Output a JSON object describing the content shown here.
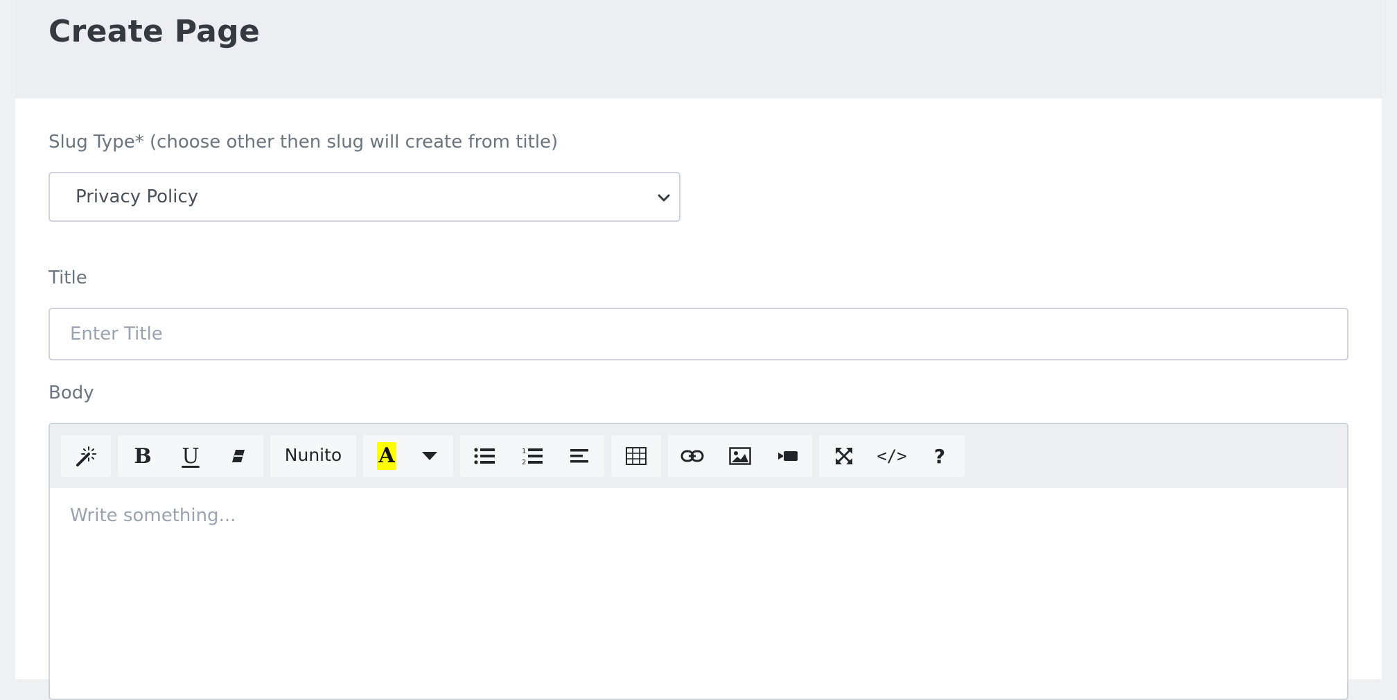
{
  "header": {
    "title": "Create Page"
  },
  "slug": {
    "label": "Slug Type* (choose other then slug will create from title)",
    "selected": "Privacy Policy"
  },
  "title_field": {
    "label": "Title",
    "placeholder": "Enter Title",
    "value": ""
  },
  "body_field": {
    "label": "Body",
    "placeholder": "Write something..."
  },
  "toolbar": {
    "font_name": "Nunito",
    "groups": [
      [
        "magic-wand-icon"
      ],
      [
        "bold-icon",
        "underline-icon",
        "eraser-icon"
      ],
      [
        "font-family-select"
      ],
      [
        "highlight-color-icon",
        "caret-down-icon"
      ],
      [
        "bullet-list-icon",
        "numbered-list-icon",
        "align-left-icon"
      ],
      [
        "table-icon"
      ],
      [
        "link-icon",
        "picture-icon",
        "video-icon"
      ],
      [
        "fullscreen-icon",
        "code-view-icon",
        "help-icon"
      ]
    ]
  },
  "colors": {
    "header_bg": "#eceef1",
    "page_bg": "#eef0f3",
    "label_text": "#6c757d",
    "title_text": "#343a40",
    "border": "#ced4da",
    "placeholder_text": "#9aa3ad",
    "highlight": "#ffff00"
  }
}
